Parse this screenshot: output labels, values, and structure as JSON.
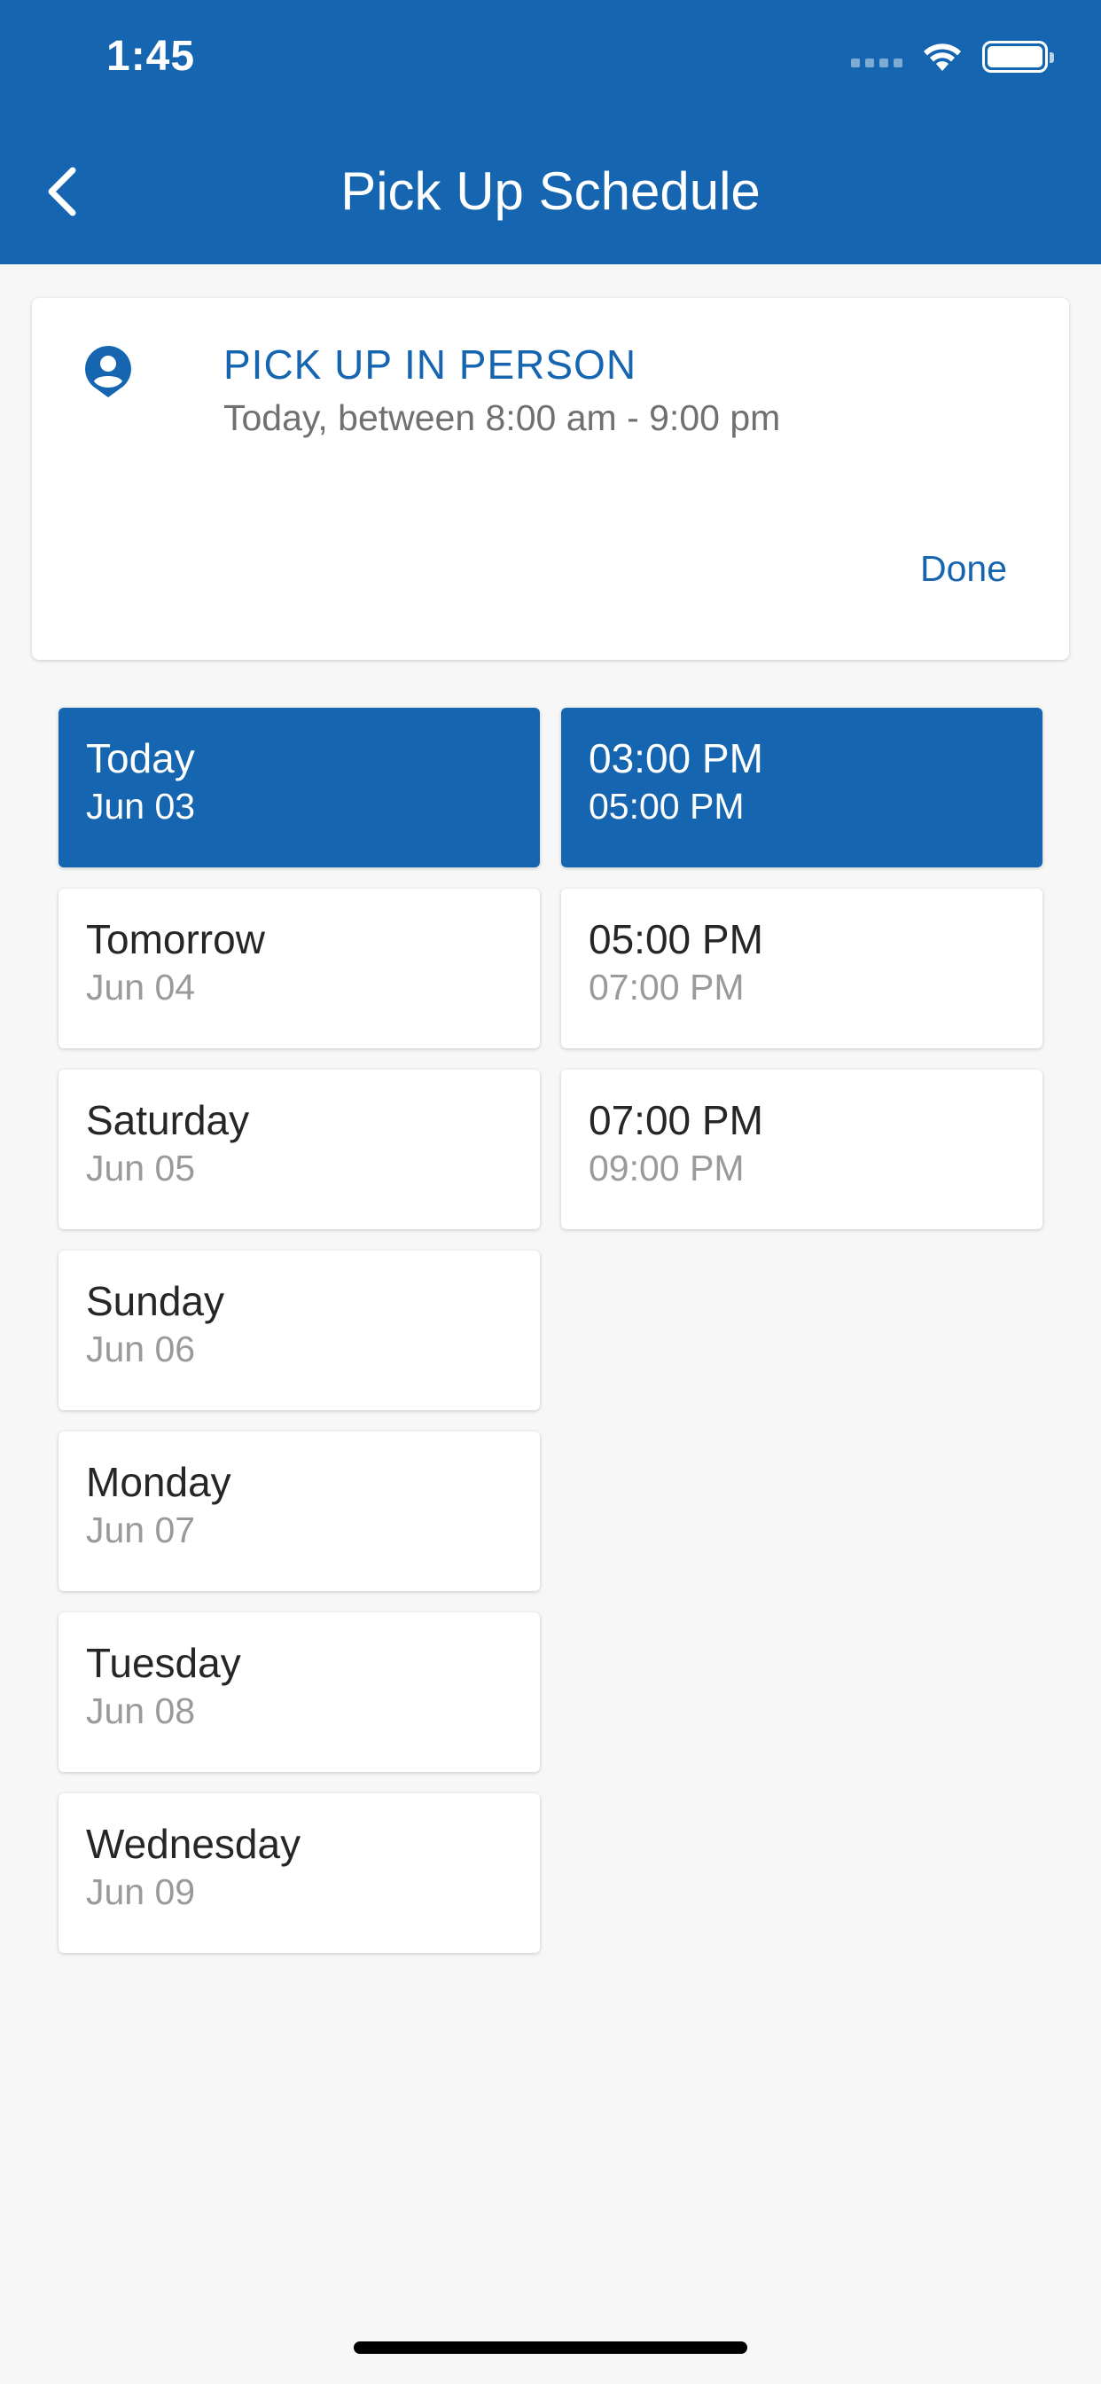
{
  "status_bar": {
    "time": "1:45"
  },
  "header": {
    "title": "Pick Up Schedule",
    "back_icon": "chevron-left-icon",
    "color": "#1565b0"
  },
  "pickup": {
    "icon": "person-pin-icon",
    "title": "PICK UP IN PERSON",
    "subtitle": "Today, between 8:00 am - 9:00 pm",
    "done_label": "Done"
  },
  "days": [
    {
      "day": "Today",
      "date": "Jun 03",
      "selected": true
    },
    {
      "day": "Tomorrow",
      "date": "Jun 04",
      "selected": false
    },
    {
      "day": "Saturday",
      "date": "Jun 05",
      "selected": false
    },
    {
      "day": "Sunday",
      "date": "Jun 06",
      "selected": false
    },
    {
      "day": "Monday",
      "date": "Jun 07",
      "selected": false
    },
    {
      "day": "Tuesday",
      "date": "Jun 08",
      "selected": false
    },
    {
      "day": "Wednesday",
      "date": "Jun 09",
      "selected": false
    }
  ],
  "times": [
    {
      "start": "03:00 PM",
      "end": "05:00 PM",
      "selected": true
    },
    {
      "start": "05:00 PM",
      "end": "07:00 PM",
      "selected": false
    },
    {
      "start": "07:00 PM",
      "end": "09:00 PM",
      "selected": false
    }
  ],
  "colors": {
    "accent": "#1565b0",
    "background": "#f7f7f7",
    "secondary_text": "#9a9a9a"
  }
}
